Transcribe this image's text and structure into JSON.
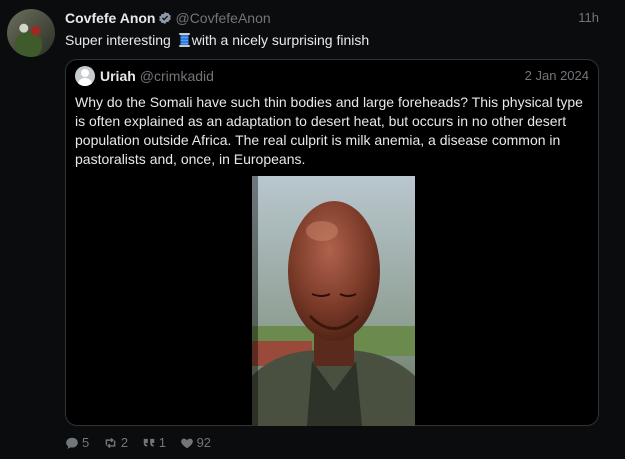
{
  "tweet": {
    "author_name": "Covfefe Anon",
    "author_handle": "@CovfefeAnon",
    "time": "11h",
    "text_before": "Super interesting ",
    "text_after": "with a nicely surprising finish",
    "emoji": "thread-spool"
  },
  "quote": {
    "author_name": "Uriah",
    "author_handle": "@crimkadid",
    "date": "2 Jan 2024",
    "text": "Why do the Somali have such thin bodies and large foreheads? This physical type is often explained as an adaptation to desert heat, but occurs in no other desert population outside Africa. The real culprit is milk anemia, a disease common in pastoralists and, once, in Europeans."
  },
  "actions": {
    "replies": "5",
    "retweets": "2",
    "quotes": "1",
    "likes": "92"
  },
  "colors": {
    "background": "#0b0c0e",
    "text": "#e7e9ea",
    "muted": "#71767b",
    "verified": "#1d9bf0",
    "border": "#2f3336"
  }
}
